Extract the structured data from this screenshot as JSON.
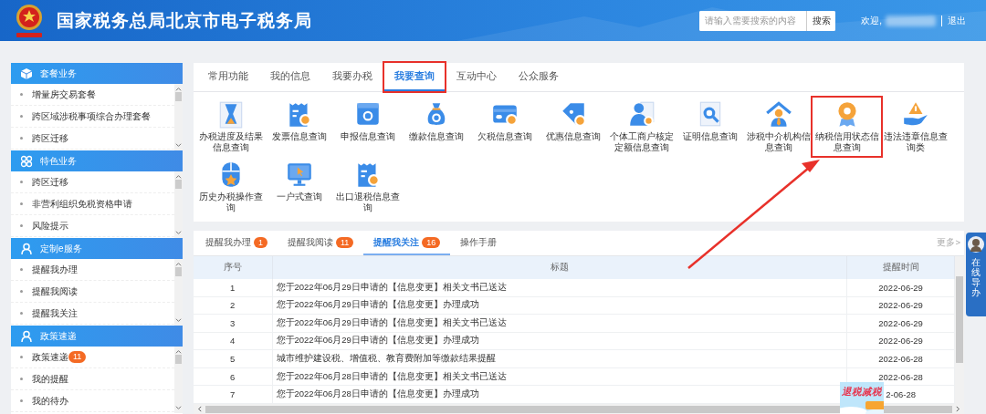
{
  "header": {
    "title": "国家税务总局北京市电子税务局",
    "search": {
      "placeholder": "请输入需要搜索的内容",
      "button": "搜索"
    },
    "greeting": "欢迎,",
    "logout": "退出"
  },
  "sidebar": {
    "sections": [
      {
        "title": "套餐业务",
        "items": [
          {
            "label": "增量房交易套餐"
          },
          {
            "label": "跨区域涉税事项综合办理套餐"
          },
          {
            "label": "跨区迁移"
          }
        ]
      },
      {
        "title": "特色业务",
        "items": [
          {
            "label": "跨区迁移"
          },
          {
            "label": "非营利组织免税资格申请"
          },
          {
            "label": "风险提示"
          }
        ]
      },
      {
        "title": "定制e服务",
        "items": [
          {
            "label": "提醒我办理"
          },
          {
            "label": "提醒我阅读"
          },
          {
            "label": "提醒我关注"
          }
        ]
      },
      {
        "title": "政策速递",
        "items": [
          {
            "label": "政策速递",
            "badge": "11"
          },
          {
            "label": "我的提醒"
          },
          {
            "label": "我的待办"
          }
        ]
      }
    ]
  },
  "services_panel": {
    "tabs": [
      {
        "label": "常用功能",
        "selected": false,
        "highlighted": false
      },
      {
        "label": "我的信息",
        "selected": false,
        "highlighted": false
      },
      {
        "label": "我要办税",
        "selected": false,
        "highlighted": false
      },
      {
        "label": "我要查询",
        "selected": true,
        "highlighted": true
      },
      {
        "label": "互动中心",
        "selected": false,
        "highlighted": false
      },
      {
        "label": "公众服务",
        "selected": false,
        "highlighted": false
      }
    ],
    "items": [
      {
        "label": "办税进度及结果信息查询",
        "highlighted": false
      },
      {
        "label": "发票信息查询",
        "highlighted": false
      },
      {
        "label": "申报信息查询",
        "highlighted": false
      },
      {
        "label": "缴款信息查询",
        "highlighted": false
      },
      {
        "label": "欠税信息查询",
        "highlighted": false
      },
      {
        "label": "优惠信息查询",
        "highlighted": false
      },
      {
        "label": "个体工商户核定定额信息查询",
        "highlighted": false
      },
      {
        "label": "证明信息查询",
        "highlighted": false
      },
      {
        "label": "涉税中介机构信息查询",
        "highlighted": false
      },
      {
        "label": "纳税信用状态信息查询",
        "highlighted": true
      },
      {
        "label": "违法违章信息查询类",
        "highlighted": false
      },
      {
        "label": "历史办税操作查询",
        "highlighted": false
      },
      {
        "label": "一户式查询",
        "highlighted": false
      },
      {
        "label": "出口退税信息查询",
        "highlighted": false
      }
    ]
  },
  "reminders_panel": {
    "tabs": [
      {
        "label": "提醒我办理",
        "badge": "1",
        "selected": false
      },
      {
        "label": "提醒我阅读",
        "badge": "11",
        "selected": false
      },
      {
        "label": "提醒我关注",
        "badge": "16",
        "selected": true
      },
      {
        "label": "操作手册",
        "selected": false
      }
    ],
    "more": "更多>",
    "table": {
      "columns": [
        "序号",
        "标题",
        "提醒时间"
      ],
      "rows": [
        {
          "no": "1",
          "title": "您于2022年06月29日申请的【信息变更】相关文书已送达",
          "time": "2022-06-29"
        },
        {
          "no": "2",
          "title": "您于2022年06月29日申请的【信息变更】办理成功",
          "time": "2022-06-29"
        },
        {
          "no": "3",
          "title": "您于2022年06月29日申请的【信息变更】相关文书已送达",
          "time": "2022-06-29"
        },
        {
          "no": "4",
          "title": "您于2022年06月29日申请的【信息变更】办理成功",
          "time": "2022-06-29"
        },
        {
          "no": "5",
          "title": "城市维护建设税、增值税、教育费附加等缴款结果提醒",
          "time": "2022-06-28"
        },
        {
          "no": "6",
          "title": "您于2022年06月28日申请的【信息变更】相关文书已送达",
          "time": "2022-06-28"
        },
        {
          "no": "7",
          "title": "您于2022年06月28日申请的【信息变更】办理成功",
          "time": "2-06-28"
        }
      ]
    }
  },
  "side_widget": {
    "label": "在线导办"
  },
  "promo_banner": {
    "text": "退税减税"
  }
}
